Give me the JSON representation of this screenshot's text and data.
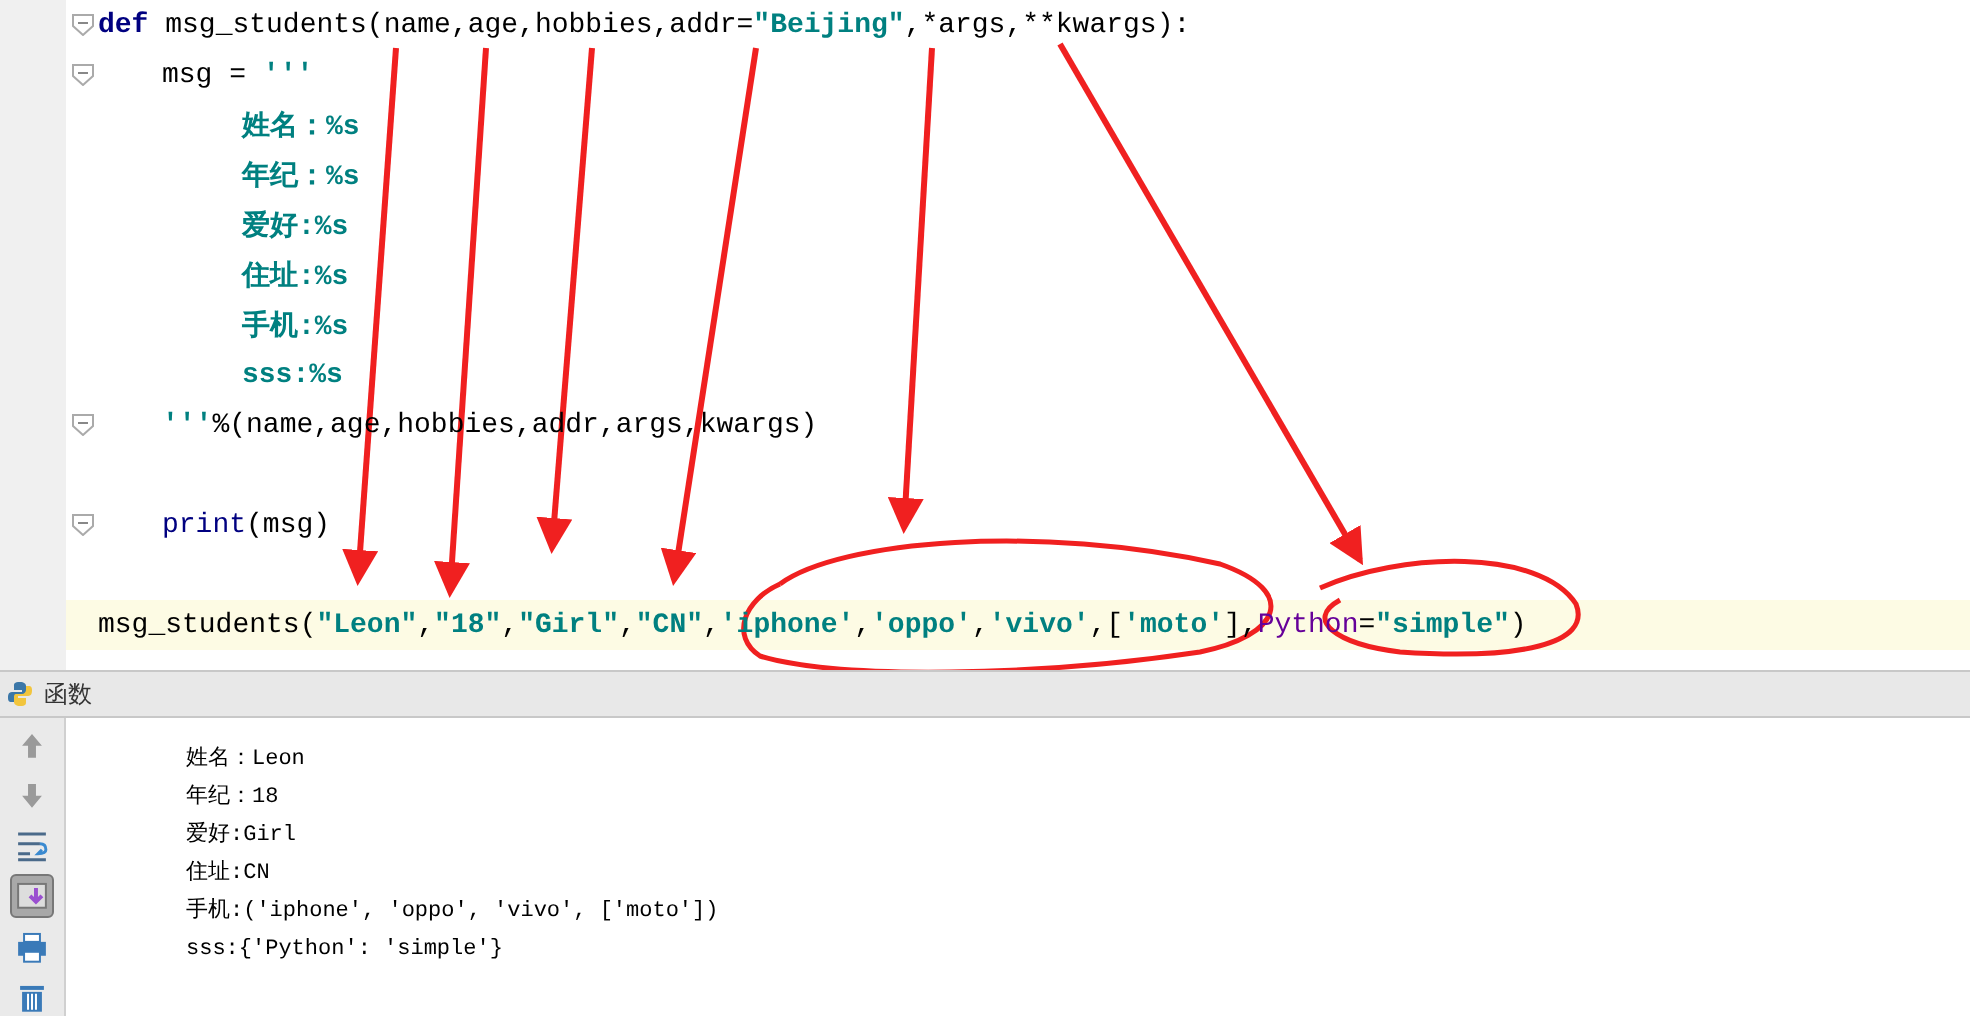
{
  "editor": {
    "lines": [
      {
        "kind": "top",
        "fold": true,
        "current": false,
        "tokens": [
          {
            "kind": "kw",
            "text": "def"
          },
          {
            "kind": "plain",
            "text": " msg_students(name,age,hobbies,addr="
          },
          {
            "kind": "str",
            "text": "\"Beijing\""
          },
          {
            "kind": "plain",
            "text": ",*args,**kwargs):"
          }
        ]
      },
      {
        "kind": "body",
        "fold": true,
        "current": false,
        "tokens": [
          {
            "kind": "plain",
            "text": "msg = "
          },
          {
            "kind": "str",
            "text": "'''"
          }
        ]
      },
      {
        "kind": "text",
        "fold": false,
        "current": false,
        "tokens": [
          {
            "kind": "str",
            "text": "姓名：%s"
          }
        ]
      },
      {
        "kind": "text",
        "fold": false,
        "current": false,
        "tokens": [
          {
            "kind": "str",
            "text": "年纪：%s"
          }
        ]
      },
      {
        "kind": "text",
        "fold": false,
        "current": false,
        "tokens": [
          {
            "kind": "str",
            "text": "爱好:%s"
          }
        ]
      },
      {
        "kind": "text",
        "fold": false,
        "current": false,
        "tokens": [
          {
            "kind": "str",
            "text": "住址:%s"
          }
        ]
      },
      {
        "kind": "text",
        "fold": false,
        "current": false,
        "tokens": [
          {
            "kind": "str",
            "text": "手机:%s"
          }
        ]
      },
      {
        "kind": "text",
        "fold": false,
        "current": false,
        "tokens": [
          {
            "kind": "str",
            "text": "sss:%s"
          }
        ]
      },
      {
        "kind": "body",
        "fold": true,
        "current": false,
        "tokens": [
          {
            "kind": "str",
            "text": "'''"
          },
          {
            "kind": "plain",
            "text": "%(name,age,hobbies,addr,args,kwargs)"
          }
        ]
      },
      {
        "kind": "body",
        "fold": false,
        "current": false
      },
      {
        "kind": "body",
        "fold": true,
        "current": false,
        "tokens": [
          {
            "kind": "builtin",
            "text": "print"
          },
          {
            "kind": "plain",
            "text": "(msg)"
          }
        ]
      },
      {
        "kind": "body",
        "fold": false,
        "current": false
      },
      {
        "kind": "top",
        "fold": false,
        "current": true,
        "tokens": [
          {
            "kind": "plain",
            "text": "msg_students("
          },
          {
            "kind": "str",
            "text": "\"Leon\""
          },
          {
            "kind": "plain",
            "text": ","
          },
          {
            "kind": "str",
            "text": "\"18\""
          },
          {
            "kind": "plain",
            "text": ","
          },
          {
            "kind": "str",
            "text": "\"Girl\""
          },
          {
            "kind": "plain",
            "text": ","
          },
          {
            "kind": "str",
            "text": "\"CN\""
          },
          {
            "kind": "plain",
            "text": ","
          },
          {
            "kind": "str",
            "text": "'iphone'"
          },
          {
            "kind": "plain",
            "text": ","
          },
          {
            "kind": "str",
            "text": "'oppo'"
          },
          {
            "kind": "plain",
            "text": ","
          },
          {
            "kind": "str",
            "text": "'vivo'"
          },
          {
            "kind": "plain",
            "text": ",["
          },
          {
            "kind": "str",
            "text": "'moto'"
          },
          {
            "kind": "plain",
            "text": "],"
          },
          {
            "kind": "kwarg",
            "text": "Python"
          },
          {
            "kind": "plain",
            "text": "="
          },
          {
            "kind": "str",
            "text": "\"simple\""
          },
          {
            "kind": "plain",
            "text": ")"
          }
        ]
      }
    ]
  },
  "run_panel": {
    "title": "函数",
    "tools": [
      {
        "kind": "up",
        "selected": false
      },
      {
        "kind": "down",
        "selected": false
      },
      {
        "kind": "wrap",
        "selected": false
      },
      {
        "kind": "scroll",
        "selected": true
      },
      {
        "kind": "print",
        "selected": false
      },
      {
        "kind": "trash",
        "selected": false
      }
    ],
    "output": [
      "姓名：Leon",
      "年纪：18",
      "爱好:Girl",
      "住址:CN",
      "手机:('iphone', 'oppo', 'vivo', ['moto'])",
      "sss:{'Python': 'simple'}"
    ]
  }
}
